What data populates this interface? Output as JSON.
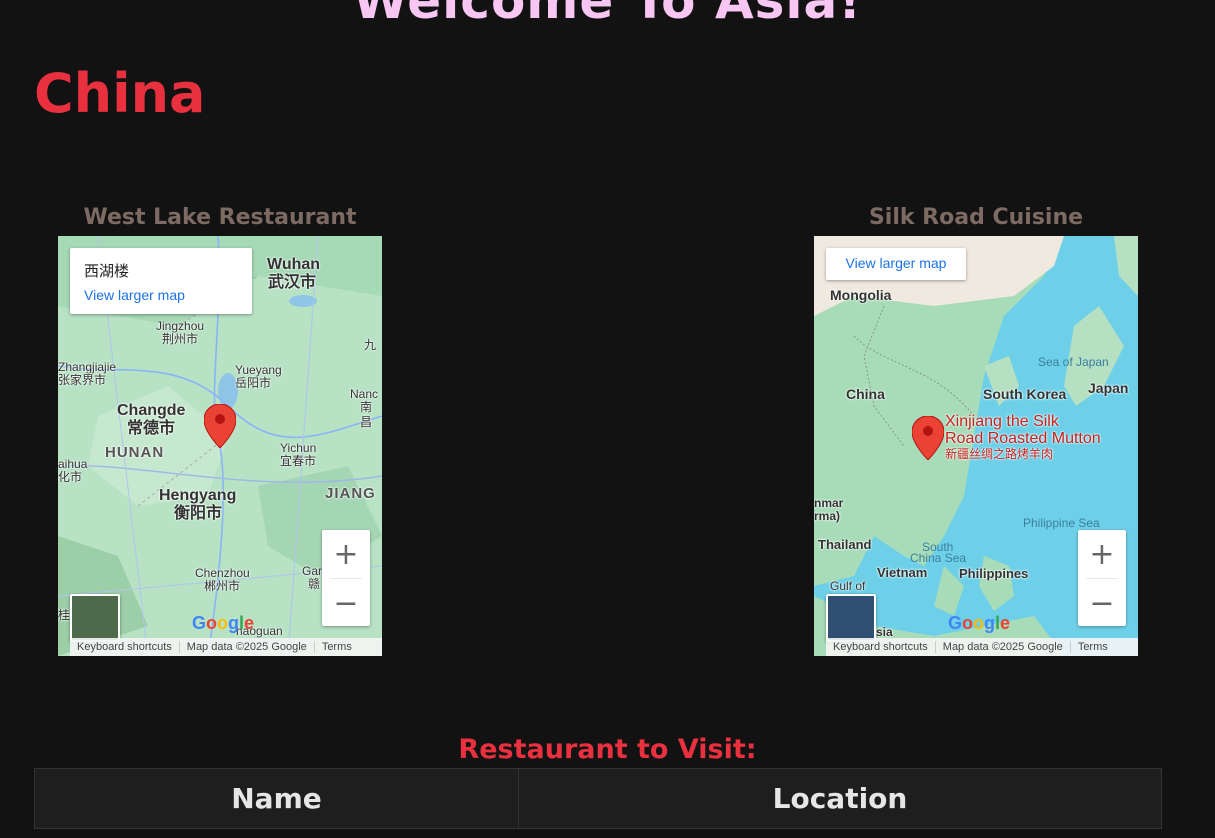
{
  "page": {
    "title": "Welcome To Asia!",
    "country": "China"
  },
  "restaurants": [
    {
      "name": "West Lake Restaurant",
      "map": {
        "place_title": "西湖楼",
        "larger_map_link": "View larger map",
        "labels": {
          "wuhan": "Wuhan",
          "wuhan_cn": "武汉市",
          "jingzhou": "Jingzhou",
          "jingzhou_cn": "荆州市",
          "jiu": "九",
          "zhangjiajie": "Zhangjiajie",
          "zhangjiajie_cn": "张家界市",
          "yueyang": "Yueyang",
          "yueyang_cn": "岳阳市",
          "nanc": "Nanc",
          "nanc_cn": "南昌",
          "changde": "Changde",
          "changde_cn": "常德市",
          "hunan": "HUNAN",
          "huaihua": "aihua",
          "huaihua_cn": "化市",
          "yichun": "Yichun",
          "yichun_cn": "宜春市",
          "hengyang": "Hengyang",
          "hengyang_cn": "衡阳市",
          "jiang": "JIANG",
          "chenzhou": "Chenzhou",
          "chenzhou_cn": "郴州市",
          "gar": "Gar",
          "gan_cn": "赣",
          "shaoguan": "haoguan",
          "gui_cn": "桂"
        },
        "google_logo": "Google",
        "attribution": [
          "Keyboard shortcuts",
          "Map data ©2025 Google",
          "Terms"
        ],
        "zoom_in": "+",
        "zoom_out": "−"
      }
    },
    {
      "name": "Silk Road Cuisine",
      "map": {
        "larger_map_link": "View larger map",
        "labels": {
          "mongolia": "Mongolia",
          "sea_of_japan": "Sea of Japan",
          "china": "China",
          "south_korea": "South Korea",
          "japan": "Japan",
          "place_name_1": "Xinjiang the Silk",
          "place_name_2": "Road Roasted Mutton",
          "place_name_cn": "新疆丝绸之路烤羊肉",
          "myanmar": "nmar",
          "myanmar_2": "rma)",
          "philippine_sea": "Philippine Sea",
          "thailand": "Thailand",
          "south_china_sea_1": "South",
          "south_china_sea_2": "China Sea",
          "vietnam": "Vietnam",
          "philippines": "Philippines",
          "gulf_of": "Gulf of",
          "malaysia": "sia"
        },
        "google_logo": "Google",
        "attribution": [
          "Keyboard shortcuts",
          "Map data ©2025 Google",
          "Terms"
        ],
        "zoom_in": "+",
        "zoom_out": "−"
      }
    }
  ],
  "table": {
    "caption": "Restaurant to Visit:",
    "headers": [
      "Name",
      "Location"
    ]
  },
  "colors": {
    "background": "#121212",
    "title": "#f7c6f2",
    "country": "#e8303f",
    "restaurant_name": "#7d6a62"
  }
}
